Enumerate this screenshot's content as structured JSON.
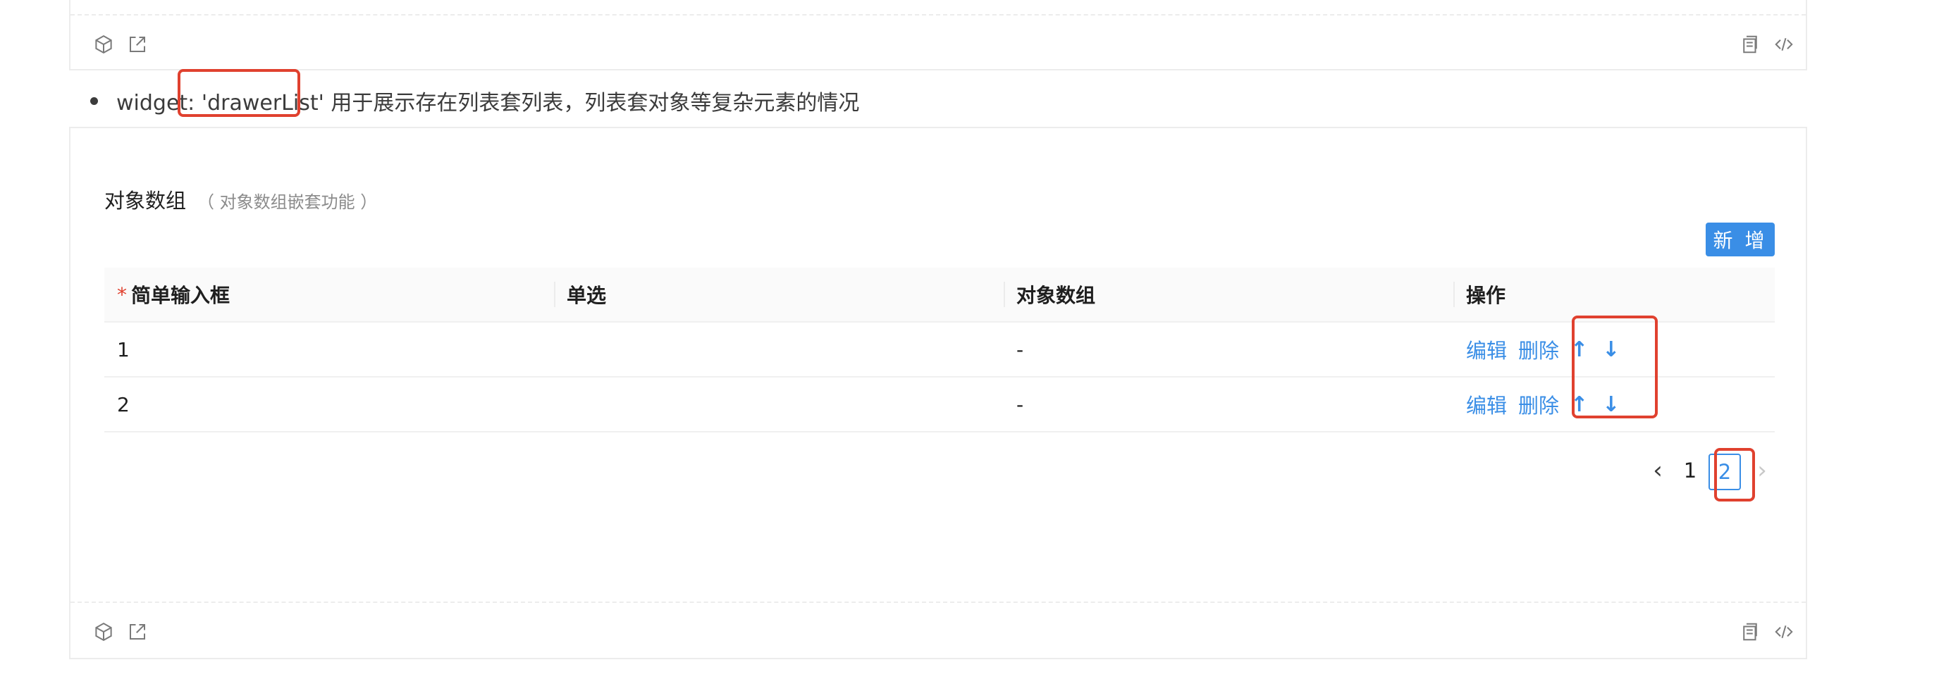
{
  "top_demo": {
    "left_icons": [
      "codesandbox-icon",
      "external-link-icon"
    ],
    "right_icons": [
      "copy-icon",
      "code-icon"
    ]
  },
  "bullet": {
    "text": "widget: 'drawerList' 用于展示存在列表套列表，列表套对象等复杂元素的情况"
  },
  "demo": {
    "title": "对象数组",
    "subtitle": "（ 对象数组嵌套功能 ）",
    "add_button": "新 增",
    "columns": [
      "简单输入框",
      "单选",
      "对象数组",
      "操作"
    ],
    "required_marker": "*",
    "rows": [
      {
        "c1": "1",
        "c2": "",
        "c3": "-"
      },
      {
        "c1": "2",
        "c2": "",
        "c3": "-"
      }
    ],
    "actions": {
      "edit": "编辑",
      "delete": "删除",
      "up": "↑",
      "down": "↓"
    },
    "pagination": {
      "prev": "‹",
      "pages": [
        "1",
        "2"
      ],
      "current": "2",
      "next": "›"
    }
  },
  "highlight_color": "#e0412f",
  "accent_color": "#3a8ee6"
}
